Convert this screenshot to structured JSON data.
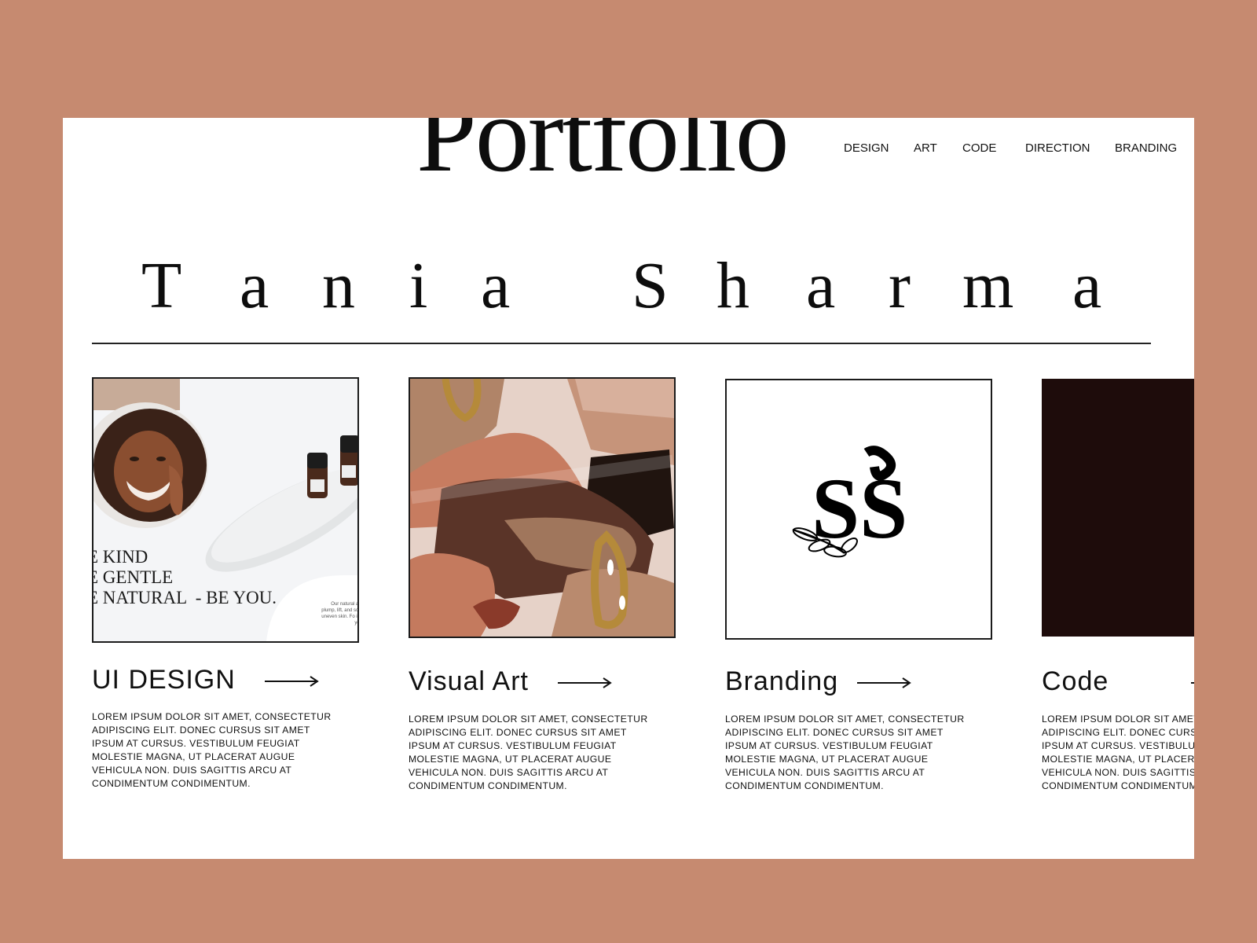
{
  "header": {
    "title": "Portfolio",
    "nav": [
      "DESIGN",
      "ART",
      "CODE",
      "DIRECTION",
      "BRANDING"
    ]
  },
  "hero": {
    "first_name_letters": [
      "T",
      "a",
      "n",
      "i",
      "a"
    ],
    "last_name_letters": [
      "S",
      "h",
      "a",
      "r",
      "m",
      "a"
    ]
  },
  "cards": [
    {
      "title": "UI DESIGN",
      "description": "LOREM IPSUM DOLOR SIT AMET, CONSECTETUR ADIPISCING ELIT. DONEC CURSUS SIT AMET IPSUM AT CURSUS. VESTIBULUM FEUGIAT MOLESTIE MAGNA, UT PLACERAT AUGUE VEHICULA NON. DUIS SAGITTIS ARCU AT CONDIMENTUM CONDIMENTUM.",
      "thumb_tagline": "E KIND\nE GENTLE\nE NATURAL  - BE YOU.",
      "thumb_small_text": "Our natural and plump, lift, and so of uneven skin. Fo into your"
    },
    {
      "title": "Visual Art",
      "description": "LOREM IPSUM DOLOR SIT AMET, CONSECTETUR ADIPISCING ELIT. DONEC CURSUS SIT AMET IPSUM AT CURSUS. VESTIBULUM FEUGIAT MOLESTIE MAGNA, UT PLACERAT AUGUE VEHICULA NON. DUIS SAGITTIS ARCU AT CONDIMENTUM CONDIMENTUM."
    },
    {
      "title": "Branding",
      "description": "LOREM IPSUM DOLOR SIT AMET, CONSECTETUR ADIPISCING ELIT. DONEC CURSUS SIT AMET IPSUM AT CURSUS. VESTIBULUM FEUGIAT MOLESTIE MAGNA, UT PLACERAT AUGUE VEHICULA NON. DUIS SAGITTIS ARCU AT CONDIMENTUM CONDIMENTUM.",
      "logo_text": "SS"
    },
    {
      "title": "Code",
      "description": "LOREM IPSUM DOLOR SIT AMET, CONSECTETUR ADIPISCING ELIT. DONEC CURSUS SIT AMET IPSUM AT CURSUS. VESTIBULUM FEUGIAT MOLESTIE MAGNA, UT PLACERAT AUGUE VEHICULA NON. DUIS SAGITTIS ARCU AT CONDIMENTUM CONDIMENTUM."
    }
  ],
  "colors": {
    "background": "#c68a70",
    "page": "#ffffff",
    "text": "#111111",
    "code_thumb": "#1e0c0b"
  }
}
